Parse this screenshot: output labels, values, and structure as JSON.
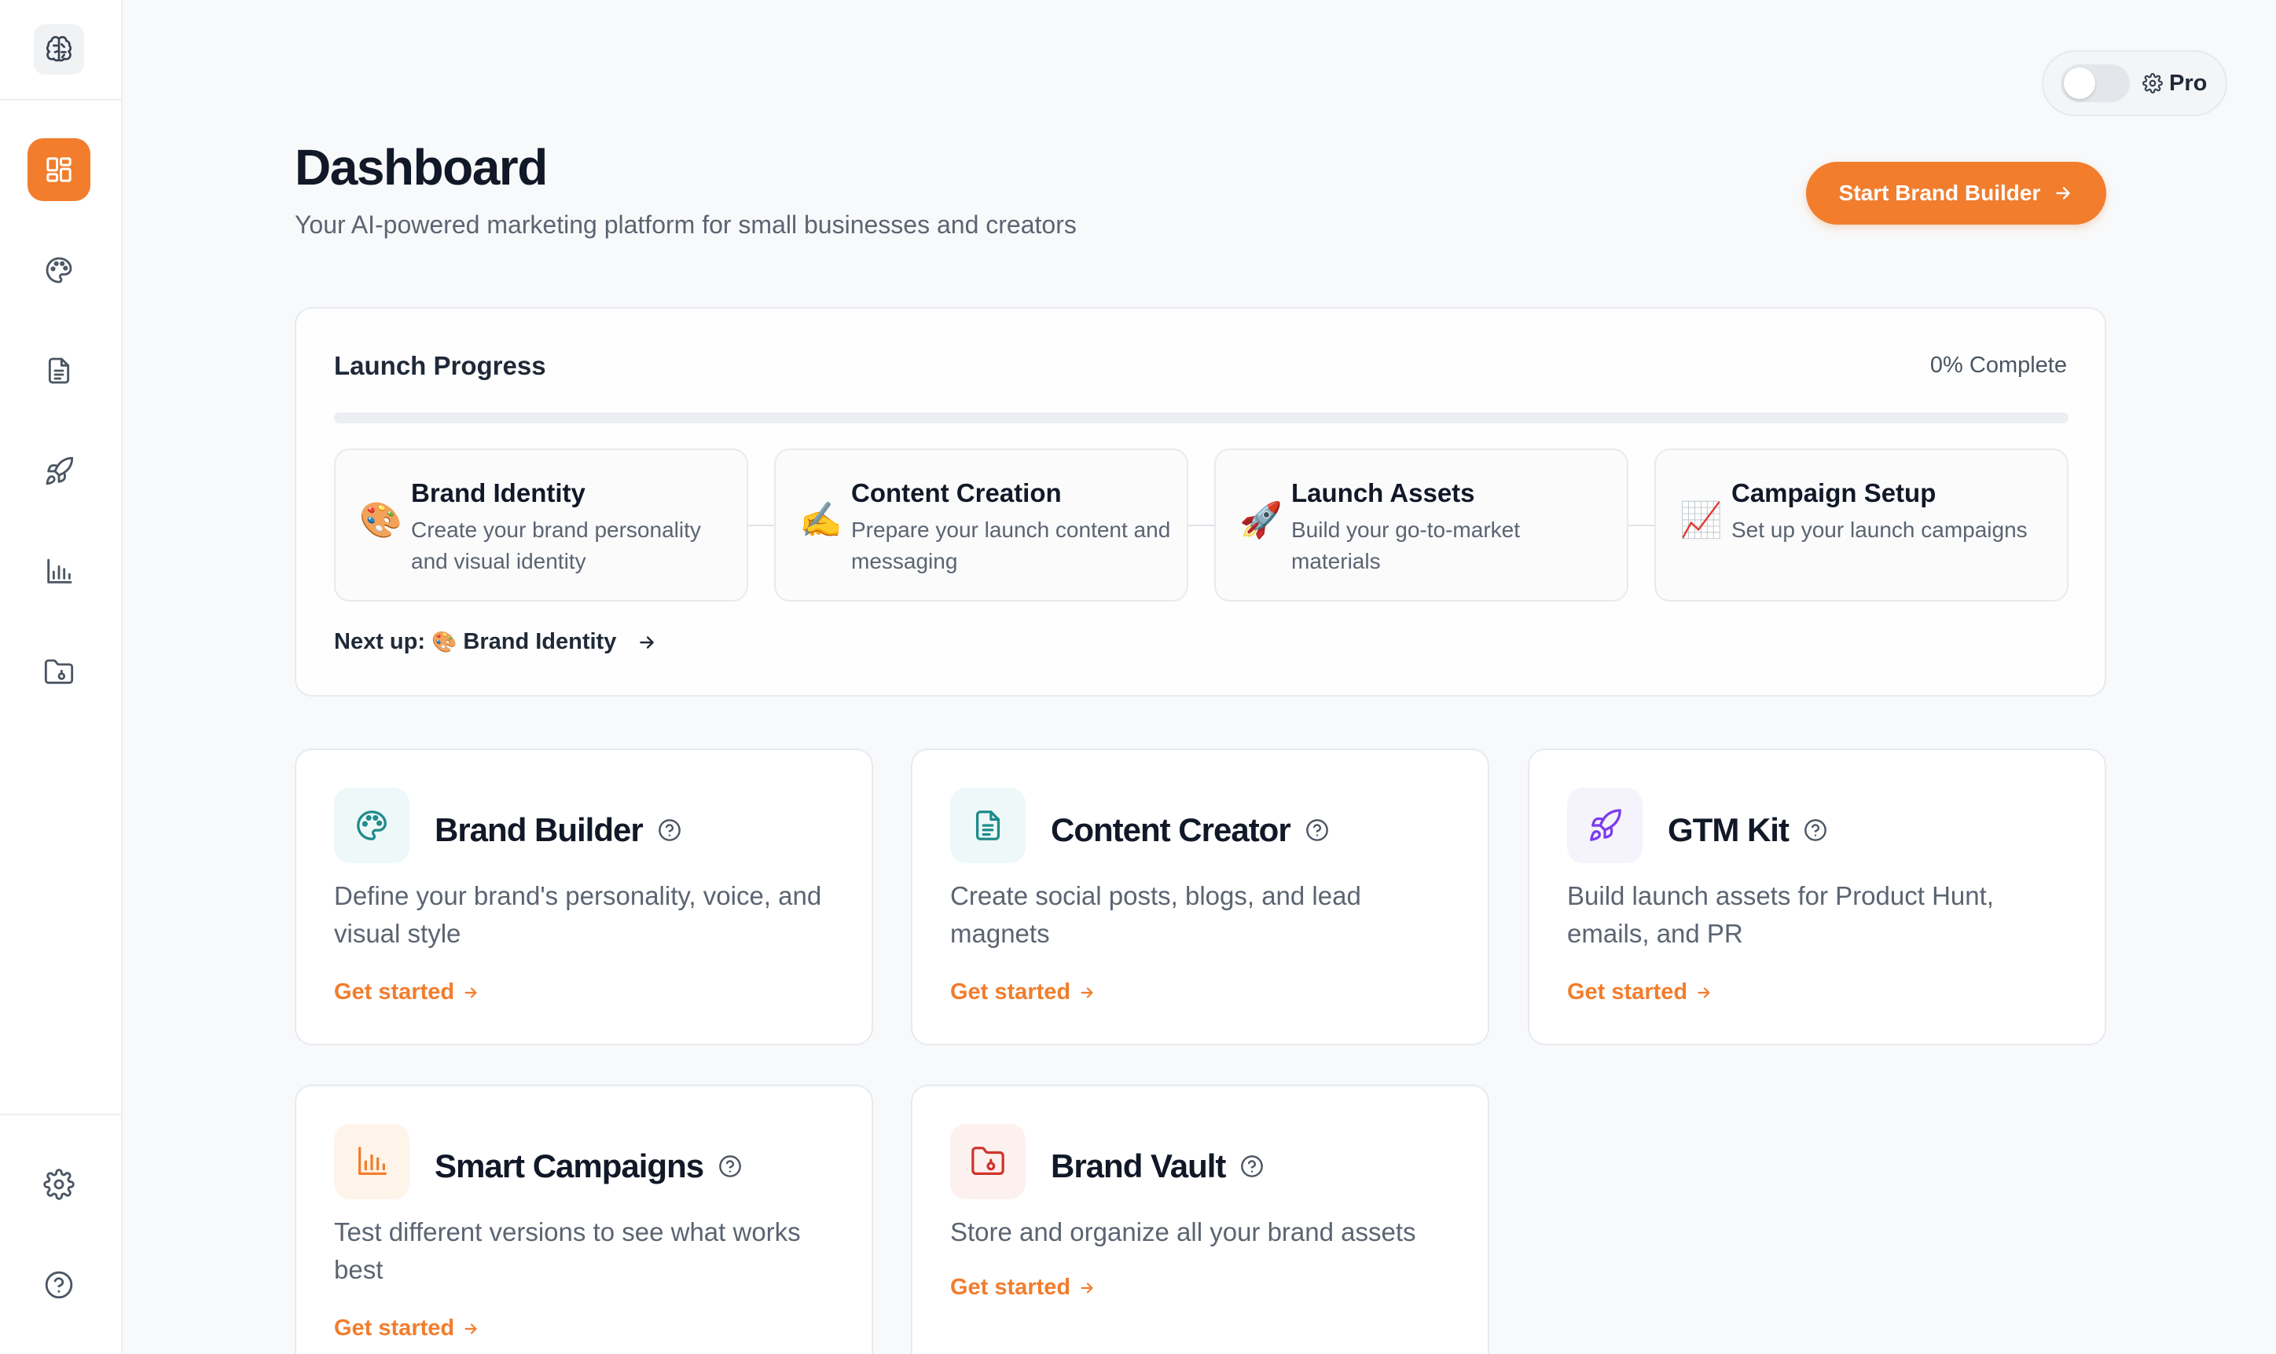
{
  "colors": {
    "accent": "#f17d2d",
    "teal": "#1f8a8a",
    "purple": "#7c3aed",
    "red": "#d0342c"
  },
  "sidebar": {
    "logo_icon": "brain-logo-icon",
    "items": [
      {
        "icon": "dashboard-grid-icon",
        "active": true
      },
      {
        "icon": "palette-icon",
        "active": false
      },
      {
        "icon": "document-icon",
        "active": false
      },
      {
        "icon": "rocket-icon",
        "active": false
      },
      {
        "icon": "bar-chart-icon",
        "active": false
      },
      {
        "icon": "folder-lock-icon",
        "active": false
      }
    ],
    "bottom_items": [
      {
        "icon": "gear-icon"
      },
      {
        "icon": "help-circle-icon"
      }
    ]
  },
  "pro_toggle": {
    "label": "Pro",
    "enabled": false
  },
  "header": {
    "title": "Dashboard",
    "subtitle": "Your AI-powered marketing platform for small businesses and creators",
    "cta_label": "Start Brand Builder"
  },
  "launch_progress": {
    "title": "Launch Progress",
    "percent_label": "0% Complete",
    "percent": 0,
    "steps": [
      {
        "emoji": "🎨",
        "title": "Brand Identity",
        "desc": "Create your brand personality and visual identity"
      },
      {
        "emoji": "✍️",
        "title": "Content Creation",
        "desc": "Prepare your launch content and messaging"
      },
      {
        "emoji": "🚀",
        "title": "Launch Assets",
        "desc": "Build your go-to-market materials"
      },
      {
        "emoji": "📈",
        "title": "Campaign Setup",
        "desc": "Set up your launch campaigns"
      }
    ],
    "next_up_label": "Next up:",
    "next_up_emoji": "🎨",
    "next_up_target": "Brand Identity"
  },
  "tools": [
    {
      "title": "Brand Builder",
      "desc": "Define your brand's personality, voice, and visual style",
      "link": "Get started",
      "icon": "palette-icon"
    },
    {
      "title": "Content Creator",
      "desc": "Create social posts, blogs, and lead magnets",
      "link": "Get started",
      "icon": "document-icon"
    },
    {
      "title": "GTM Kit",
      "desc": "Build launch assets for Product Hunt, emails, and PR",
      "link": "Get started",
      "icon": "rocket-icon"
    },
    {
      "title": "Smart Campaigns",
      "desc": "Test different versions to see what works best",
      "link": "Get started",
      "icon": "bar-chart-icon"
    },
    {
      "title": "Brand Vault",
      "desc": "Store and organize all your brand assets",
      "link": "Get started",
      "icon": "folder-lock-icon"
    }
  ]
}
